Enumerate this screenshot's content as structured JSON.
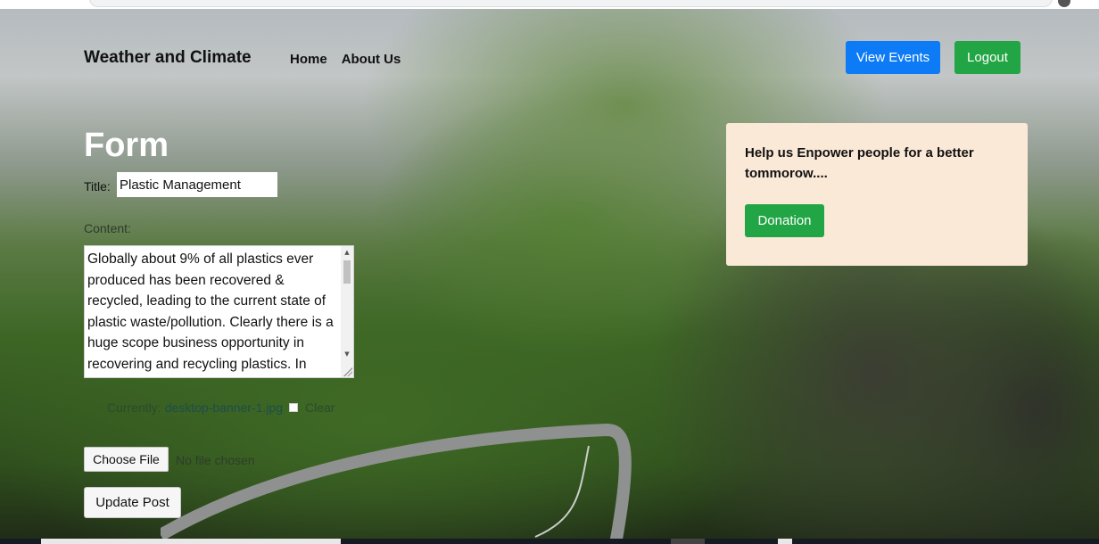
{
  "navbar": {
    "brand": "Weather and Climate",
    "links": [
      "Home",
      "About Us"
    ],
    "view_events_label": "View Events",
    "logout_label": "Logout"
  },
  "form": {
    "heading": "Form",
    "title_label": "Title:",
    "title_value": "Plastic Management",
    "content_label": "Content:",
    "content_value": "Globally about 9% of all plastics ever produced has been recovered & recycled, leading to the current state of plastic waste/pollution. Clearly there is a huge scope business opportunity in recovering and recycling plastics. In",
    "image": {
      "currently_label": "Currently:",
      "current_file": "desktop-banner-1.jpg",
      "clear_label": "Clear"
    },
    "choose_file_label": "Choose File",
    "no_file_text": "No file chosen",
    "submit_label": "Update Post"
  },
  "donation": {
    "text": "Help us Enpower people for a better tommorow....",
    "button_label": "Donation"
  },
  "colors": {
    "primary": "#0d7bf5",
    "success": "#22a544",
    "card_bg": "#fbe9d8"
  }
}
